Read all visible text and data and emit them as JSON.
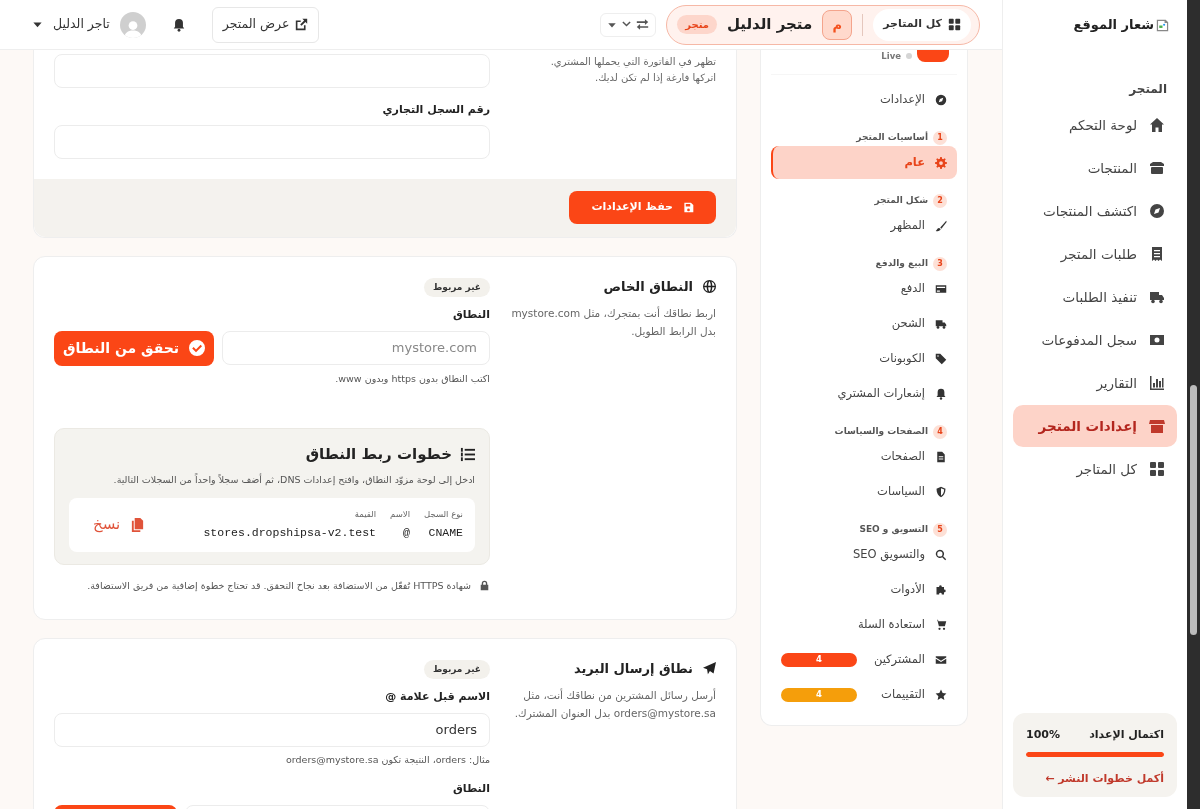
{
  "header": {
    "all_stores": "كل المتاجر",
    "store_initial": "م",
    "store_name": "متجر الدليل",
    "store_tag": "متجر",
    "view_store": "عرض المتجر",
    "user_name": "تاجر الدليل"
  },
  "sidebar": {
    "logo_alt": "شعار الموقع",
    "section": "المتجر",
    "items": [
      {
        "label": "لوحة التحكم",
        "selected": false
      },
      {
        "label": "المنتجات",
        "selected": false
      },
      {
        "label": "اكتشف المنتجات",
        "selected": false
      },
      {
        "label": "طلبات المتجر",
        "selected": false
      },
      {
        "label": "تنفيذ الطلبات",
        "selected": false
      },
      {
        "label": "سجل المدفوعات",
        "selected": false
      },
      {
        "label": "التقارير",
        "selected": false
      },
      {
        "label": "إعدادات المتجر",
        "selected": true
      },
      {
        "label": "كل المتاجر",
        "selected": false
      }
    ],
    "progress": {
      "title": "اكتمال الإعداد",
      "percent": "100%",
      "level": 1,
      "link": "أكمل خطوات النشر ←"
    }
  },
  "settings_nav": {
    "status": "Live",
    "top_item": {
      "label": "الإعدادات",
      "selected": false
    },
    "groups": [
      {
        "number": "1",
        "title": "أساسيات المتجر",
        "items": [
          {
            "label": "عام",
            "selected": true
          }
        ]
      },
      {
        "number": "2",
        "title": "شكل المتجر",
        "items": [
          {
            "label": "المظهر",
            "selected": false
          }
        ]
      },
      {
        "number": "3",
        "title": "البيع والدفع",
        "items": [
          {
            "label": "الدفع",
            "selected": false
          },
          {
            "label": "الشحن",
            "selected": false
          },
          {
            "label": "الكوبونات",
            "selected": false
          },
          {
            "label": "إشعارات المشتري",
            "selected": false
          }
        ]
      },
      {
        "number": "4",
        "title": "الصفحات والسياسات",
        "items": [
          {
            "label": "الصفحات",
            "selected": false
          },
          {
            "label": "السياسات",
            "selected": false
          }
        ]
      },
      {
        "number": "5",
        "title": "التسويق و SEO",
        "items": [
          {
            "label": "والتسويق SEO",
            "selected": false
          },
          {
            "label": "الأدوات",
            "selected": false
          },
          {
            "label": "استعادة السلة",
            "selected": false
          },
          {
            "label": "المشتركين",
            "selected": false,
            "badge": "4",
            "color": "#fb4616"
          },
          {
            "label": "التقييمات",
            "selected": false,
            "badge": "4",
            "color": "#f59e0b"
          }
        ]
      }
    ]
  },
  "invoice_card": {
    "help": [
      "تظهر في الفاتورة التي يحملها المشتري.",
      "اتركها فارغة إذا لم تكن لديك."
    ],
    "cr_label": "رقم السجل التجاري",
    "save_button": "حفظ الإعدادات"
  },
  "domain_card": {
    "title": "النطاق الخاص",
    "description": "اربط نطاقك أنت بمتجرك، مثل mystore.com بدل الرابط الطويل.",
    "status": "غير مربوط",
    "field_label": "النطاق",
    "placeholder": "mystore.com",
    "verify_button": "تحقق من النطاق",
    "hint": "اكتب النطاق بدون https وبدون www.",
    "steps": {
      "title": "خطوات ربط النطاق",
      "description": "ادخل إلى لوحة مزوّد النطاق، وافتح إعدادات DNS، ثم أضف سجلاً واحداً من السجلات التالية.",
      "columns": [
        "نوع السجل",
        "الاسم",
        "القيمة"
      ],
      "record": [
        "CNAME",
        "@",
        "stores.dropshipsa-v2.test"
      ],
      "copy_button": "نسخ"
    },
    "note": "شهادة HTTPS تُفعّل من الاستضافة بعد نجاح التحقق. قد تحتاج خطوة إضافية من فريق الاستضافة."
  },
  "email_card": {
    "title": "نطاق إرسال البريد",
    "description": "أرسل رسائل المشترين من نطاقك أنت، مثل orders@mystore.sa بدل العنوان المشترك.",
    "status": "غير مربوط",
    "name_label": "الاسم قبل علامة @",
    "name_value": "orders",
    "name_hint": "مثال: orders، النتيجة تكون orders@mystore.sa",
    "domain_label": "النطاق"
  }
}
